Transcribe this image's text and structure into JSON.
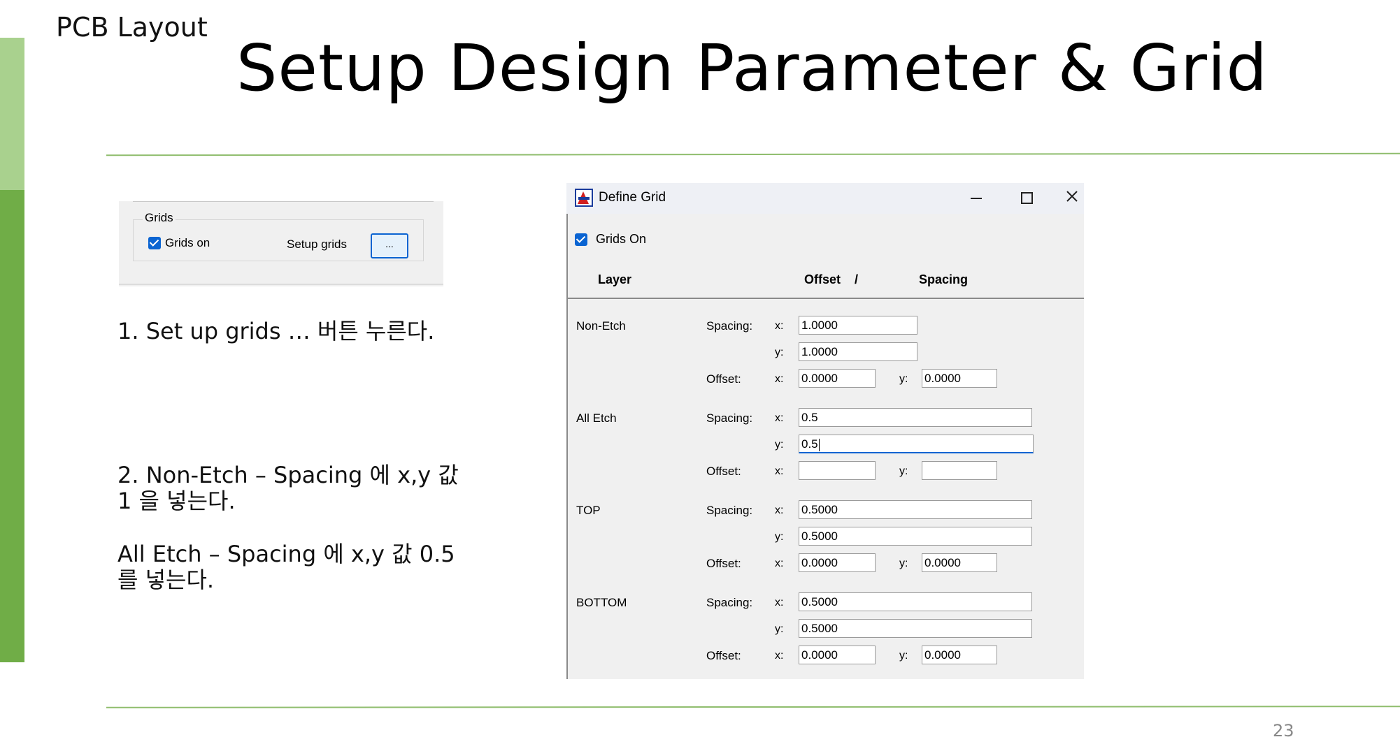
{
  "slide": {
    "doc_label": "PCB Layout",
    "title": "Setup Design Parameter & Grid",
    "page_number": "23",
    "instructions": [
      "1. Set up grids … 버튼 누른다.",
      "2. Non-Etch – Spacing 에 x,y 값 1 을 넣는다.",
      "All Etch – Spacing 에 x,y 값 0.5를 넣는다."
    ]
  },
  "grids_panel": {
    "group_title": "Grids",
    "grids_on_label": "Grids on",
    "grids_on_checked": true,
    "setup_label": "Setup grids",
    "setup_button_label": "..."
  },
  "dialog": {
    "title": "Define Grid",
    "grids_on_label": "Grids On",
    "grids_on_checked": true,
    "headers": {
      "layer": "Layer",
      "offset": "Offset",
      "slash": "/",
      "spacing": "Spacing"
    },
    "labels": {
      "spacing": "Spacing:",
      "offset": "Offset:",
      "x": "x:",
      "y": "y:"
    },
    "layers": [
      {
        "name": "Non-Etch",
        "spacing_x": "1.0000",
        "spacing_y": "1.0000",
        "offset_x": "0.0000",
        "offset_y": "0.0000"
      },
      {
        "name": "All Etch",
        "spacing_x": "0.5",
        "spacing_y": "0.5",
        "offset_x": "",
        "offset_y": ""
      },
      {
        "name": "TOP",
        "spacing_x": "0.5000",
        "spacing_y": "0.5000",
        "offset_x": "0.0000",
        "offset_y": "0.0000"
      },
      {
        "name": "BOTTOM",
        "spacing_x": "0.5000",
        "spacing_y": "0.5000",
        "offset_x": "0.0000",
        "offset_y": "0.0000"
      }
    ]
  },
  "colors": {
    "accent_light": "#a9d18e",
    "accent_dark": "#70ad47",
    "focus_blue": "#0a64d2"
  }
}
